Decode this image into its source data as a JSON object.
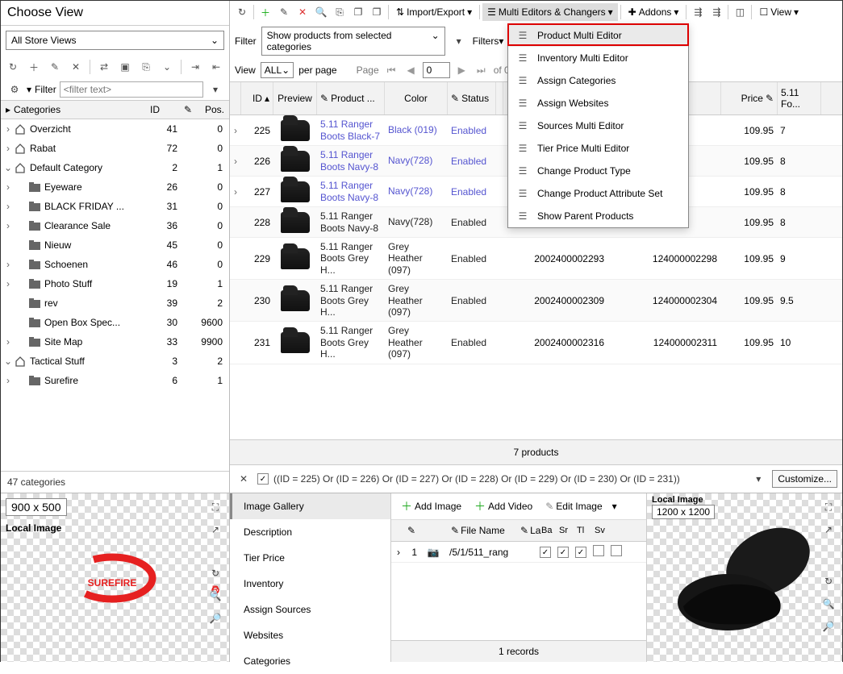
{
  "left": {
    "title": "Choose View",
    "store_select": "All Store Views",
    "filter_label": "Filter",
    "filter_placeholder": "<filter text>",
    "cat_header": {
      "name": "Categories",
      "id": "ID",
      "edit": "",
      "pos": "Pos."
    },
    "categories": [
      {
        "indent": 0,
        "exp": "›",
        "icon": "home",
        "name": "Overzicht",
        "id": 41,
        "pos": 0
      },
      {
        "indent": 0,
        "exp": "›",
        "icon": "home",
        "name": "Rabat",
        "id": 72,
        "pos": 0
      },
      {
        "indent": 0,
        "exp": "⌄",
        "icon": "home",
        "name": "Default Category",
        "id": 2,
        "pos": 1
      },
      {
        "indent": 1,
        "exp": "›",
        "icon": "folder",
        "name": "Eyeware",
        "id": 26,
        "pos": 0
      },
      {
        "indent": 1,
        "exp": "›",
        "icon": "folder",
        "name": "BLACK FRIDAY ...",
        "id": 31,
        "pos": 0
      },
      {
        "indent": 1,
        "exp": "›",
        "icon": "folder",
        "name": "Clearance Sale",
        "id": 36,
        "pos": 0
      },
      {
        "indent": 1,
        "exp": "",
        "icon": "folder",
        "name": "Nieuw",
        "id": 45,
        "pos": 0
      },
      {
        "indent": 1,
        "exp": "›",
        "icon": "folder",
        "name": "Schoenen",
        "id": 46,
        "pos": 0
      },
      {
        "indent": 1,
        "exp": "›",
        "icon": "folder",
        "name": "Photo Stuff",
        "id": 19,
        "pos": 1
      },
      {
        "indent": 1,
        "exp": "",
        "icon": "folder",
        "name": "rev",
        "id": 39,
        "pos": 2
      },
      {
        "indent": 1,
        "exp": "",
        "icon": "folder",
        "name": "Open Box Spec...",
        "id": 30,
        "pos": 9600
      },
      {
        "indent": 1,
        "exp": "›",
        "icon": "folder",
        "name": "Site Map",
        "id": 33,
        "pos": 9900
      },
      {
        "indent": 0,
        "exp": "⌄",
        "icon": "home",
        "name": "Tactical Stuff",
        "id": 3,
        "pos": 2
      },
      {
        "indent": 1,
        "exp": "›",
        "icon": "folder",
        "name": "Surefire",
        "id": 6,
        "pos": 1
      }
    ],
    "cat_count": "47 categories",
    "preview": {
      "dim": "900 x 500",
      "label": "Local Image",
      "logo": "SUREFIRE"
    }
  },
  "toolbar": {
    "import_export": "Import/Export",
    "multi_editors": "Multi Editors & Changers",
    "addons": "Addons",
    "view": "View"
  },
  "filters": {
    "label": "Filter",
    "select": "Show products from selected categories",
    "filters_btn": "Filters"
  },
  "paging": {
    "view": "View",
    "all": "ALL",
    "per_page": "per page",
    "page": "Page",
    "num": "0",
    "of": "of 0 pag..."
  },
  "grid_head": {
    "id": "ID",
    "preview": "Preview",
    "product": "Product ...",
    "color": "Color",
    "status": "Status",
    "price": "Price",
    "fo": "5.11 Fo..."
  },
  "rows": [
    {
      "id": "225",
      "name": "5.11 Ranger Boots Black-7",
      "color": "Black (019)",
      "status": "Enabled",
      "sku": "",
      "bc": "",
      "price": "109.95",
      "fo": "7",
      "link": true
    },
    {
      "id": "226",
      "name": "5.11 Ranger Boots Navy-8",
      "color": "Navy(728)",
      "status": "Enabled",
      "sku": "",
      "bc": "",
      "price": "109.95",
      "fo": "8",
      "link": true
    },
    {
      "id": "227",
      "name": "5.11 Ranger Boots Navy-8",
      "color": "Navy(728)",
      "status": "Enabled",
      "sku": "",
      "bc": "",
      "price": "109.95",
      "fo": "8",
      "link": true
    },
    {
      "id": "228",
      "name": "5.11 Ranger Boots Navy-8",
      "color": "Navy(728)",
      "status": "Enabled",
      "sku": "",
      "bc": "",
      "price": "109.95",
      "fo": "8",
      "link": false
    },
    {
      "id": "229",
      "name": "5.11 Ranger Boots Grey H...",
      "color": "Grey Heather (097)",
      "status": "Enabled",
      "sku": "2002400002293",
      "bc": "124000002298",
      "price": "109.95",
      "fo": "9",
      "link": false
    },
    {
      "id": "230",
      "name": "5.11 Ranger Boots Grey H...",
      "color": "Grey Heather (097)",
      "status": "Enabled",
      "sku": "2002400002309",
      "bc": "124000002304",
      "price": "109.95",
      "fo": "9.5",
      "link": false
    },
    {
      "id": "231",
      "name": "5.11 Ranger Boots Grey H...",
      "color": "Grey Heather (097)",
      "status": "Enabled",
      "sku": "2002400002316",
      "bc": "124000002311",
      "price": "109.95",
      "fo": "10",
      "link": false
    }
  ],
  "grid_footer": "7 products",
  "expression": "((ID = 225) Or (ID = 226) Or (ID = 227) Or (ID = 228) Or (ID = 229) Or (ID = 230) Or (ID = 231))",
  "customize": "Customize...",
  "dd_menu": [
    "Product Multi Editor",
    "Inventory Multi Editor",
    "Assign Categories",
    "Assign Websites",
    "Sources Multi Editor",
    "Tier Price Multi Editor",
    "Change Product Type",
    "Change Product Attribute Set",
    "Show Parent Products"
  ],
  "bottom": {
    "tabs": [
      "Image Gallery",
      "Description",
      "Tier Price",
      "Inventory",
      "Assign Sources",
      "Websites",
      "Categories"
    ],
    "add_image": "Add Image",
    "add_video": "Add Video",
    "edit_image": "Edit Image",
    "img_head": {
      "file": "File Name",
      "la": "La",
      "ba": "Ba",
      "sr": "Sr",
      "th": "Tl",
      "sv": "Sv"
    },
    "img_row": {
      "num": "1",
      "file": "/5/1/511_rang"
    },
    "records": "1 records",
    "right_dim": "1200 x 1200",
    "right_label": "Local Image"
  }
}
